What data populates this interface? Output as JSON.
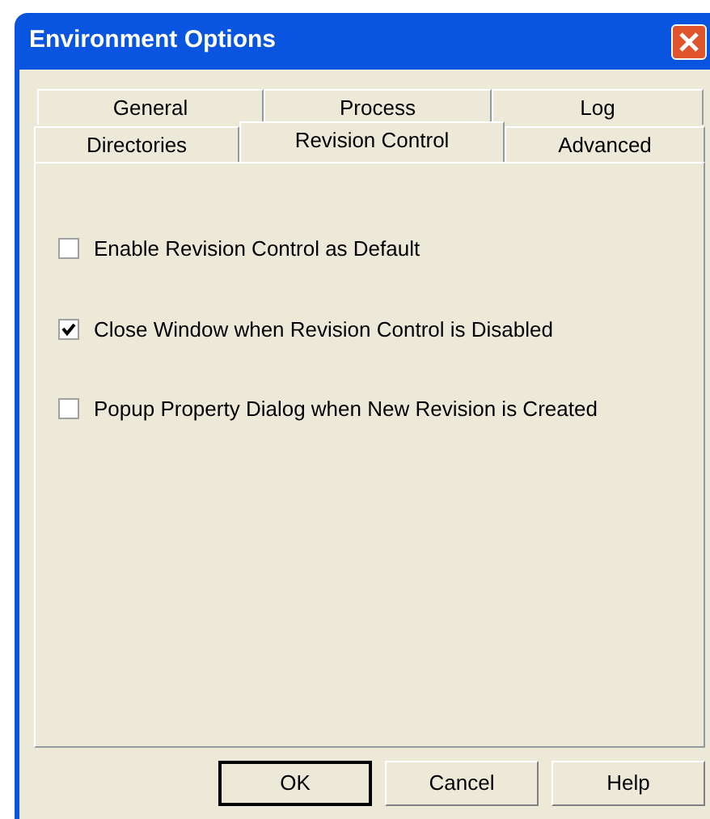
{
  "window": {
    "title": "Environment Options"
  },
  "tab_rows": [
    [
      {
        "label": "General",
        "selected": false
      },
      {
        "label": "Process",
        "selected": false
      },
      {
        "label": "Log",
        "selected": false
      }
    ],
    [
      {
        "label": "Directories",
        "selected": false
      },
      {
        "label": "Revision Control",
        "selected": true
      },
      {
        "label": "Advanced",
        "selected": false
      }
    ]
  ],
  "options": [
    {
      "label": "Enable Revision Control as Default",
      "checked": false
    },
    {
      "label": "Close Window when Revision Control is Disabled",
      "checked": true
    },
    {
      "label": "Popup Property Dialog when New Revision is Created",
      "checked": false
    }
  ],
  "buttons": [
    {
      "label": "OK",
      "default": true
    },
    {
      "label": "Cancel",
      "default": false
    },
    {
      "label": "Help",
      "default": false
    }
  ]
}
